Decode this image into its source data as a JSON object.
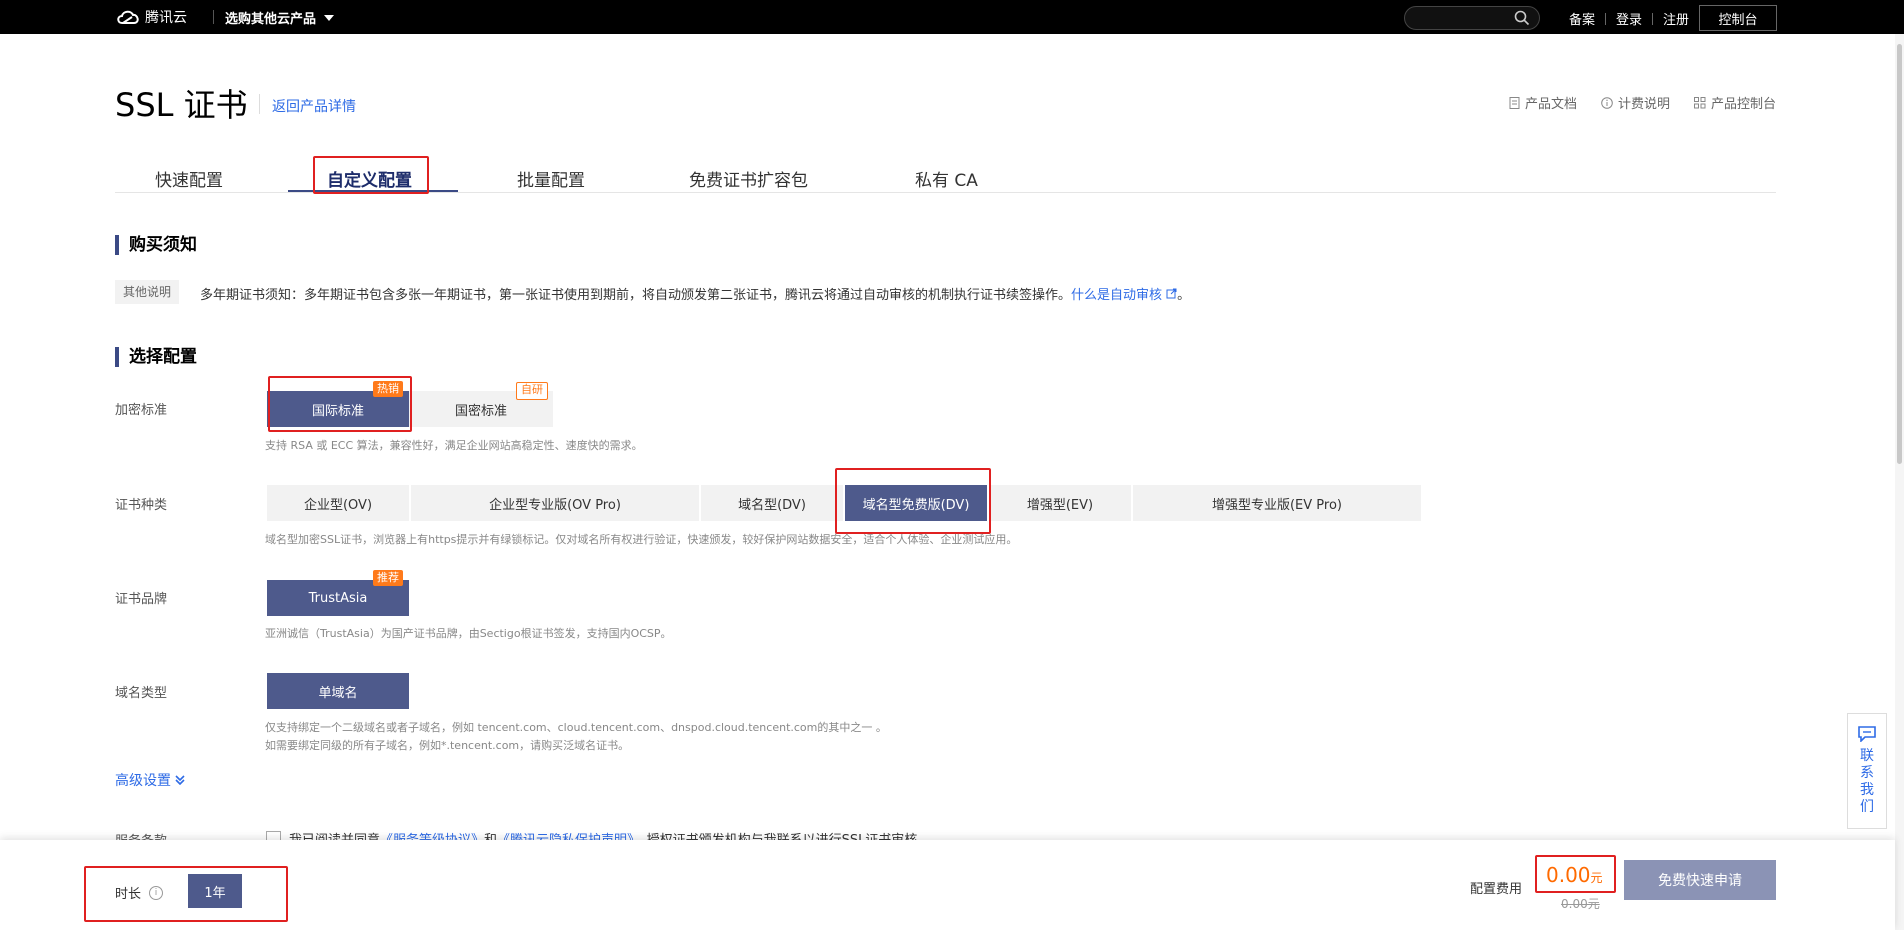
{
  "topbar": {
    "brand": "腾讯云",
    "menu_label": "选购其他云产品",
    "search_placeholder": "",
    "links": [
      "备案",
      "登录",
      "注册"
    ],
    "console_label": "控制台"
  },
  "header": {
    "title": "SSL 证书",
    "back_link": "返回产品详情",
    "right_links": [
      "产品文档",
      "计费说明",
      "产品控制台"
    ]
  },
  "tabs": [
    "快速配置",
    "自定义配置",
    "批量配置",
    "免费证书扩容包",
    "私有 CA"
  ],
  "active_tab": "自定义配置",
  "purchase_notice": {
    "title": "购买须知",
    "tag": "其他说明",
    "text": "多年期证书须知：多年期证书包含多张一年期证书，第一张证书使用到期前，将自动颁发第二张证书，腾讯云将通过自动审核的机制执行证书续签操作。",
    "link": "什么是自动审核",
    "tail": "。"
  },
  "config": {
    "title": "选择配置",
    "encryption": {
      "label": "加密标准",
      "options": [
        "国际标准",
        "国密标准"
      ],
      "selected": "国际标准",
      "badges": [
        "热销",
        "自研"
      ],
      "desc": "支持 RSA 或 ECC 算法，兼容性好，满足企业网站高稳定性、速度快的需求。"
    },
    "cert_type": {
      "label": "证书种类",
      "options": [
        "企业型(OV)",
        "企业型专业版(OV Pro)",
        "域名型(DV)",
        "域名型免费版(DV)",
        "增强型(EV)",
        "增强型专业版(EV Pro)"
      ],
      "selected": "域名型免费版(DV)",
      "desc": "域名型加密SSL证书，浏览器上有https提示并有绿锁标记。仅对域名所有权进行验证，快速颁发，较好保护网站数据安全，适合个人体验、企业测试应用。"
    },
    "brand": {
      "label": "证书品牌",
      "options": [
        "TrustAsia"
      ],
      "badge": "推荐",
      "desc": "亚洲诚信（TrustAsia）为国产证书品牌，由Sectigo根证书签发，支持国内OCSP。"
    },
    "domain_type": {
      "label": "域名类型",
      "options": [
        "单域名"
      ],
      "desc_line1": "仅支持绑定一个二级域名或者子域名，例如 tencent.com、cloud.tencent.com、dnspod.cloud.tencent.com的其中之一 。",
      "desc_line2": "如需要绑定同级的所有子域名，例如*.tencent.com，请购买泛域名证书。"
    },
    "advanced": "高级设置",
    "terms": {
      "label": "服务条款",
      "text_pre": "我已阅读并同意",
      "link1": "《服务等级协议》",
      "and": "和",
      "link2": "《腾讯云隐私保护声明》",
      "text_post": "，授权证书颁发机构与我联系以进行SSL证书审核"
    }
  },
  "contact": "联系我们",
  "bottom": {
    "duration_label": "时长",
    "duration_value": "1年",
    "fee_label": "配置费用",
    "price": "0.00",
    "unit": "元",
    "original_price": "0.00元",
    "apply_label": "免费快速申请"
  }
}
